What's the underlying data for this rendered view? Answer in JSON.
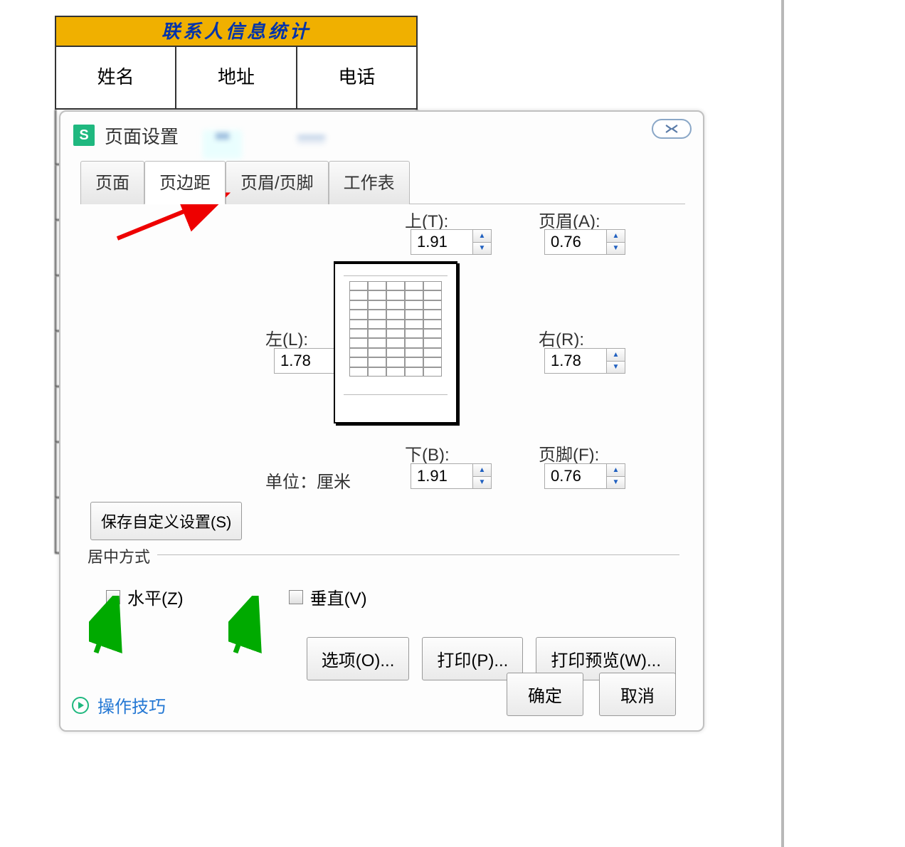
{
  "background": {
    "title": "联系人信息统计",
    "headers": [
      "姓名",
      "地址",
      "电话"
    ]
  },
  "dialog": {
    "title": "页面设置",
    "close": "X",
    "tabs": [
      "页面",
      "页边距",
      "页眉/页脚",
      "工作表"
    ],
    "activeTab": 1,
    "margins": {
      "top_label": "上(T):",
      "top": "1.91",
      "header_label": "页眉(A):",
      "header": "0.76",
      "left_label": "左(L):",
      "left": "1.78",
      "right_label": "右(R):",
      "right": "1.78",
      "bottom_label": "下(B):",
      "bottom": "1.91",
      "footer_label": "页脚(F):",
      "footer": "0.76",
      "unit_label": "单位：厘米"
    },
    "save_custom": "保存自定义设置(S)",
    "center": {
      "legend": "居中方式",
      "horizontal": "水平(Z)",
      "vertical": "垂直(V)"
    },
    "buttons": {
      "options": "选项(O)...",
      "print": "打印(P)...",
      "preview": "打印预览(W)..."
    },
    "tips": "操作技巧",
    "ok": "确定",
    "cancel": "取消"
  }
}
